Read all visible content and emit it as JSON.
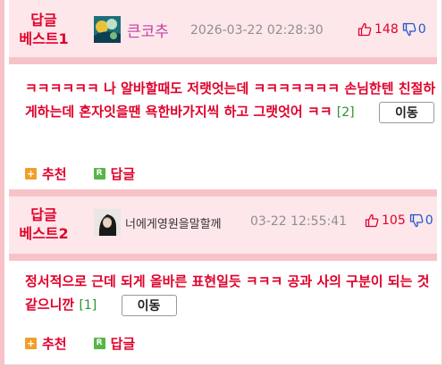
{
  "comments": [
    {
      "best_label_line1": "답글",
      "best_label_line2": "베스트1",
      "nickname": "큰코추",
      "datetime": "2026-03-22 02:28:30",
      "upvotes": "148",
      "downvotes": "0",
      "text": "ㅋㅋㅋㅋㅋㅋ 나 알바할때도 저랫엇는데 ㅋㅋㅋㅋㅋㅋㅋ 손님한텐 친절하게하는데 혼자잇을땐 욕한바가지씩 하고 그랫엇어 ㅋㅋ",
      "reply_count": "[2]",
      "move_label": "이동",
      "recommend_label": "추천",
      "reply_label": "답글"
    },
    {
      "best_label_line1": "답글",
      "best_label_line2": "베스트2",
      "nickname": "너에게영원을말할께",
      "datetime": "03-22 12:55:41",
      "upvotes": "105",
      "downvotes": "0",
      "text": "정서적으로 근데 되게 올바른 표현일듯 ㅋㅋㅋ 공과 사의 구분이 되는 것 같으니깐",
      "reply_count": "[1]",
      "move_label": "이동",
      "recommend_label": "추천",
      "reply_label": "답글"
    }
  ],
  "icons": {
    "thumb_up": "thumbs-up-icon",
    "thumb_down": "thumbs-down-icon",
    "recommend": "plus-icon",
    "reply": "reply-r-icon"
  },
  "colors": {
    "accent_red": "#e0002a",
    "border_pink": "#f7c3c9",
    "header_bg": "#fde7ea",
    "nick1": "#c23fa6",
    "reply_count_green": "#2f8f2f",
    "downvote_blue": "#2255cc"
  }
}
